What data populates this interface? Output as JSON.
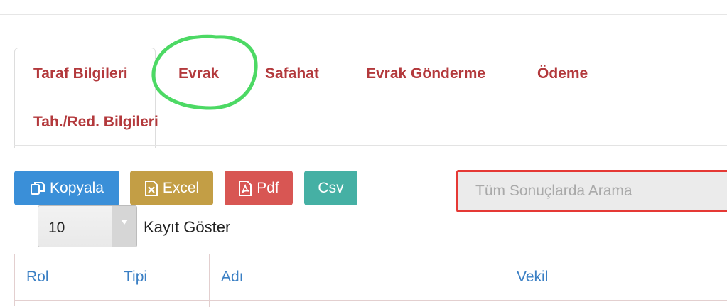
{
  "tabs": [
    {
      "label": "Taraf Bilgileri"
    },
    {
      "label": "Evrak"
    },
    {
      "label": "Safahat"
    },
    {
      "label": "Evrak Gönderme"
    },
    {
      "label": "Ödeme"
    },
    {
      "label": "Tah./Red. Bilgileri"
    }
  ],
  "buttons": {
    "copy": "Kopyala",
    "excel": "Excel",
    "pdf": "Pdf",
    "csv": "Csv"
  },
  "search": {
    "placeholder": "Tüm Sonuçlarda Arama",
    "value": ""
  },
  "length": {
    "value": "10",
    "label": "Kayıt Göster"
  },
  "table": {
    "headers": [
      "Rol",
      "Tipi",
      "Adı",
      "Vekil"
    ]
  },
  "colors": {
    "tab_text": "#b3393c",
    "annotation_circle": "#4cd964",
    "search_highlight": "#e53935",
    "header_text": "#3a7fc4"
  }
}
